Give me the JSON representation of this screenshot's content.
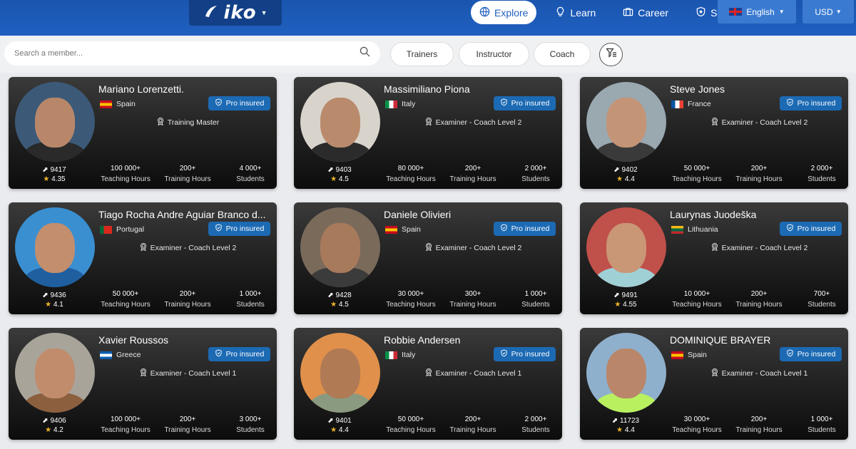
{
  "header": {
    "logo": "iko",
    "nav": [
      {
        "label": "Explore",
        "icon": "globe-icon",
        "active": true
      },
      {
        "label": "Learn",
        "icon": "lightbulb-icon",
        "active": false
      },
      {
        "label": "Career",
        "icon": "briefcase-icon",
        "active": false
      },
      {
        "label": "Safety",
        "icon": "shield-icon",
        "active": false
      }
    ],
    "language": "English",
    "currency": "USD"
  },
  "search": {
    "placeholder": "Search a member...",
    "filters": [
      "Trainers",
      "Instructor",
      "Coach"
    ]
  },
  "members": [
    {
      "name": "Mariano Lorenzetti.",
      "country": "Spain",
      "flag_colors": [
        "#c60b1e",
        "#ffc400",
        "#c60b1e"
      ],
      "badge": "Pro insured",
      "role": "Training Master",
      "id": "9417",
      "rating": "4.35",
      "avatar_bg": "#3c5a78",
      "skin": "#b8876a",
      "shirt": "#2a2a2a",
      "stats": [
        {
          "value": "100 000+",
          "label": "Teaching Hours"
        },
        {
          "value": "200+",
          "label": "Training Hours"
        },
        {
          "value": "4 000+",
          "label": "Students"
        }
      ]
    },
    {
      "name": "Massimiliano Piona",
      "country": "Italy",
      "flag_colors": [
        "#009246",
        "#ffffff",
        "#ce2b37"
      ],
      "badge": "Pro insured",
      "role": "Examiner - Coach Level 2",
      "id": "9403",
      "rating": "4.5",
      "avatar_bg": "#d8d4cc",
      "skin": "#b98b6c",
      "shirt": "#2b2b2b",
      "stats": [
        {
          "value": "80 000+",
          "label": "Teaching Hours"
        },
        {
          "value": "200+",
          "label": "Training Hours"
        },
        {
          "value": "2 000+",
          "label": "Students"
        }
      ]
    },
    {
      "name": "Steve Jones",
      "country": "France",
      "flag_colors": [
        "#0055a4",
        "#ffffff",
        "#ef4135"
      ],
      "badge": "Pro insured",
      "role": "Examiner - Coach Level 2",
      "id": "9402",
      "rating": "4.4",
      "avatar_bg": "#9aa8b0",
      "skin": "#c49476",
      "shirt": "#3a3a3a",
      "stats": [
        {
          "value": "50 000+",
          "label": "Teaching Hours"
        },
        {
          "value": "200+",
          "label": "Training Hours"
        },
        {
          "value": "2 000+",
          "label": "Students"
        }
      ]
    },
    {
      "name": "Tiago Rocha Andre Aguiar Branco d...",
      "country": "Portugal",
      "flag_colors": [
        "#046a38",
        "#da291c",
        "#da291c"
      ],
      "badge": "Pro insured",
      "role": "Examiner - Coach Level 2",
      "id": "9436",
      "rating": "4.1",
      "avatar_bg": "#3a8fd0",
      "skin": "#c28e6e",
      "shirt": "#1f5fa0",
      "stats": [
        {
          "value": "50 000+",
          "label": "Teaching Hours"
        },
        {
          "value": "200+",
          "label": "Training Hours"
        },
        {
          "value": "1 000+",
          "label": "Students"
        }
      ]
    },
    {
      "name": "Daniele Olivieri",
      "country": "Spain",
      "flag_colors": [
        "#c60b1e",
        "#ffc400",
        "#c60b1e"
      ],
      "badge": "Pro insured",
      "role": "Examiner - Coach Level 2",
      "id": "9428",
      "rating": "4.5",
      "avatar_bg": "#7a6a5a",
      "skin": "#a87a5c",
      "shirt": "#3b3b3b",
      "stats": [
        {
          "value": "30 000+",
          "label": "Teaching Hours"
        },
        {
          "value": "300+",
          "label": "Training Hours"
        },
        {
          "value": "1 000+",
          "label": "Students"
        }
      ]
    },
    {
      "name": "Laurynas Juodeška",
      "country": "Lithuania",
      "flag_colors": [
        "#fdb913",
        "#006a44",
        "#c1272d"
      ],
      "badge": "Pro insured",
      "role": "Examiner - Coach Level 2",
      "id": "9491",
      "rating": "4.55",
      "avatar_bg": "#c0504a",
      "skin": "#c99676",
      "shirt": "#9fd0d6",
      "stats": [
        {
          "value": "10 000+",
          "label": "Teaching Hours"
        },
        {
          "value": "200+",
          "label": "Training Hours"
        },
        {
          "value": "700+",
          "label": "Students"
        }
      ]
    },
    {
      "name": "Xavier Roussos",
      "country": "Greece",
      "flag_colors": [
        "#0d5eaf",
        "#ffffff",
        "#0d5eaf"
      ],
      "badge": "Pro insured",
      "role": "Examiner - Coach Level 1",
      "id": "9406",
      "rating": "4.2",
      "avatar_bg": "#a8a49a",
      "skin": "#c08c6c",
      "shirt": "#8c5f3e",
      "stats": [
        {
          "value": "100 000+",
          "label": "Teaching Hours"
        },
        {
          "value": "200+",
          "label": "Training Hours"
        },
        {
          "value": "3 000+",
          "label": "Students"
        }
      ]
    },
    {
      "name": "Robbie Andersen",
      "country": "Italy",
      "flag_colors": [
        "#009246",
        "#ffffff",
        "#ce2b37"
      ],
      "badge": "Pro insured",
      "role": "Examiner - Coach Level 1",
      "id": "9401",
      "rating": "4.4",
      "avatar_bg": "#e0904a",
      "skin": "#b07a55",
      "shirt": "#8a9a80",
      "stats": [
        {
          "value": "50 000+",
          "label": "Teaching Hours"
        },
        {
          "value": "200+",
          "label": "Training Hours"
        },
        {
          "value": "2 000+",
          "label": "Students"
        }
      ]
    },
    {
      "name": "DOMINIQUE BRAYER",
      "country": "Spain",
      "flag_colors": [
        "#c60b1e",
        "#ffc400",
        "#c60b1e"
      ],
      "badge": "Pro insured",
      "role": "Examiner - Coach Level 1",
      "id": "11723",
      "rating": "4.4",
      "avatar_bg": "#8fb0cc",
      "skin": "#b9866a",
      "shirt": "#b8f060",
      "stats": [
        {
          "value": "30 000+",
          "label": "Teaching Hours"
        },
        {
          "value": "200+",
          "label": "Training Hours"
        },
        {
          "value": "1 000+",
          "label": "Students"
        }
      ]
    }
  ]
}
